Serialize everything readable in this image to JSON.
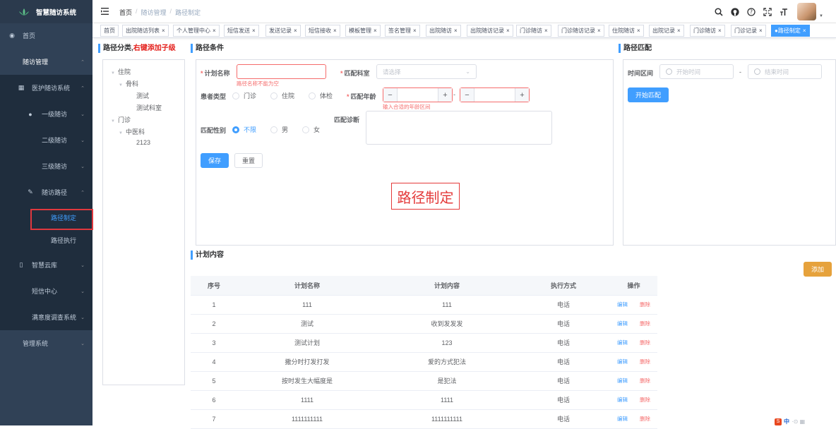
{
  "app": {
    "title": "智慧随访系统"
  },
  "sidebar": {
    "items": [
      {
        "label": "首页"
      },
      {
        "label": "随访管理"
      },
      {
        "label": "医护随访系统"
      },
      {
        "label": "一级随访"
      },
      {
        "label": "二级随访"
      },
      {
        "label": "三级随访"
      },
      {
        "label": "随访路径"
      },
      {
        "label": "路径制定"
      },
      {
        "label": "路径执行"
      },
      {
        "label": "智慧云库"
      },
      {
        "label": "短信中心"
      },
      {
        "label": "满意度调查系统"
      },
      {
        "label": "管理系统"
      }
    ]
  },
  "breadcrumb": {
    "home": "首页",
    "sep": "/",
    "level1": "随访管理",
    "current": "路径制定"
  },
  "tabs": [
    {
      "label": "首页",
      "closable": false
    },
    {
      "label": "出院随访列表",
      "closable": true
    },
    {
      "label": "个人管理中心",
      "closable": true
    },
    {
      "label": "短信发送",
      "closable": true
    },
    {
      "label": "发送记录",
      "closable": true
    },
    {
      "label": "短信接收",
      "closable": true
    },
    {
      "label": "模板管理",
      "closable": true
    },
    {
      "label": "签名管理",
      "closable": true
    },
    {
      "label": "出院随访",
      "closable": true
    },
    {
      "label": "出院随访记录",
      "closable": true
    },
    {
      "label": "门诊随访",
      "closable": true
    },
    {
      "label": "门诊随访记录",
      "closable": true
    },
    {
      "label": "住院随访",
      "closable": true
    },
    {
      "label": "出院记录",
      "closable": true
    },
    {
      "label": "门诊随访",
      "closable": true
    },
    {
      "label": "门诊记录",
      "closable": true
    },
    {
      "label": "●路径制定",
      "closable": true,
      "active": true
    }
  ],
  "tree_panel": {
    "title_prefix": "路径分类,",
    "title_hint": "右键添加子级",
    "nodes": [
      {
        "label": "住院"
      },
      {
        "label": "骨科"
      },
      {
        "label": "测试"
      },
      {
        "label": "测试科室"
      },
      {
        "label": "门诊"
      },
      {
        "label": "中医科"
      },
      {
        "label": "2123"
      }
    ]
  },
  "conditions": {
    "title": "路径条件",
    "plan_name_label": "计划名称",
    "plan_name_error": "路径名称不能为空",
    "dept_label": "匹配科室",
    "dept_placeholder": "请选择",
    "patient_type_label": "患者类型",
    "patient_types": [
      "门诊",
      "住院",
      "体检"
    ],
    "age_label": "匹配年龄",
    "age_error": "输入合适的年龄区间",
    "age_dash": "-",
    "gender_label": "匹配性别",
    "genders": [
      "不限",
      "男",
      "女"
    ],
    "diagnosis_label": "匹配诊断",
    "save_label": "保存",
    "reset_label": "重置",
    "watermark": "路径制定"
  },
  "match_panel": {
    "title": "路径匹配",
    "range_label": "时间区间",
    "start_placeholder": "开始时间",
    "end_placeholder": "结束时间",
    "range_sep": "-",
    "match_button": "开始匹配"
  },
  "plan": {
    "title": "计划内容",
    "add_button": "添加",
    "columns": [
      "序号",
      "计划名称",
      "计划内容",
      "执行方式",
      "操作"
    ],
    "edit_label": "编辑",
    "delete_label": "删除",
    "rows": [
      {
        "no": "1",
        "name": "111",
        "content": "111",
        "method": "电话"
      },
      {
        "no": "2",
        "name": "测试",
        "content": "收到发发发",
        "method": "电话"
      },
      {
        "no": "3",
        "name": "测试计划",
        "content": "123",
        "method": "电话"
      },
      {
        "no": "4",
        "name": "撒分时打发打发",
        "content": "爱的方式犯法",
        "method": "电话"
      },
      {
        "no": "5",
        "name": "按时发生大幅度是",
        "content": "是犯法",
        "method": "电话"
      },
      {
        "no": "6",
        "name": "1111",
        "content": "1111",
        "method": "电话"
      },
      {
        "no": "7",
        "name": "1111111111",
        "content": "1111111111",
        "method": "电话"
      }
    ]
  },
  "ime_badge": {
    "s": "S",
    "text": "中",
    "extra": "·⊙ ▦"
  }
}
